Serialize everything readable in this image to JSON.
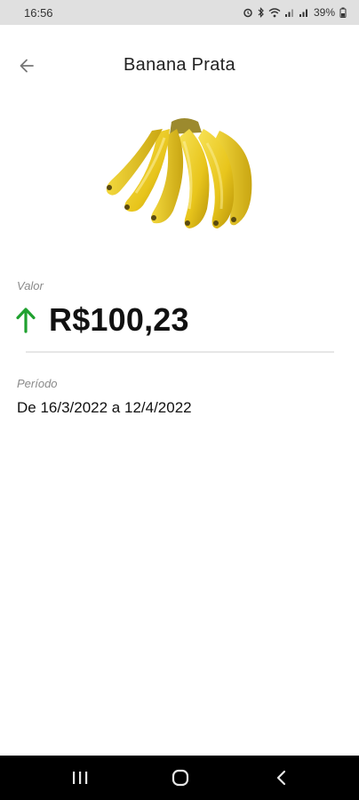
{
  "status_bar": {
    "time": "16:56",
    "battery": "39%",
    "icons": [
      "alarm-icon",
      "bluetooth-icon",
      "wifi-icon",
      "signal-icon",
      "signal-icon",
      "battery-icon"
    ]
  },
  "header": {
    "title": "Banana Prata",
    "back_icon": "arrow-left-icon"
  },
  "product": {
    "image": "banana-bunch-image"
  },
  "value_section": {
    "label": "Valor",
    "trend_icon": "arrow-up-icon",
    "trend_color": "#1fa12f",
    "amount": "R$100,23"
  },
  "period_section": {
    "label": "Período",
    "text": "De 16/3/2022 a 12/4/2022"
  },
  "nav": {
    "recent_icon": "recent-apps-icon",
    "home_icon": "home-icon",
    "back_icon": "back-icon"
  }
}
